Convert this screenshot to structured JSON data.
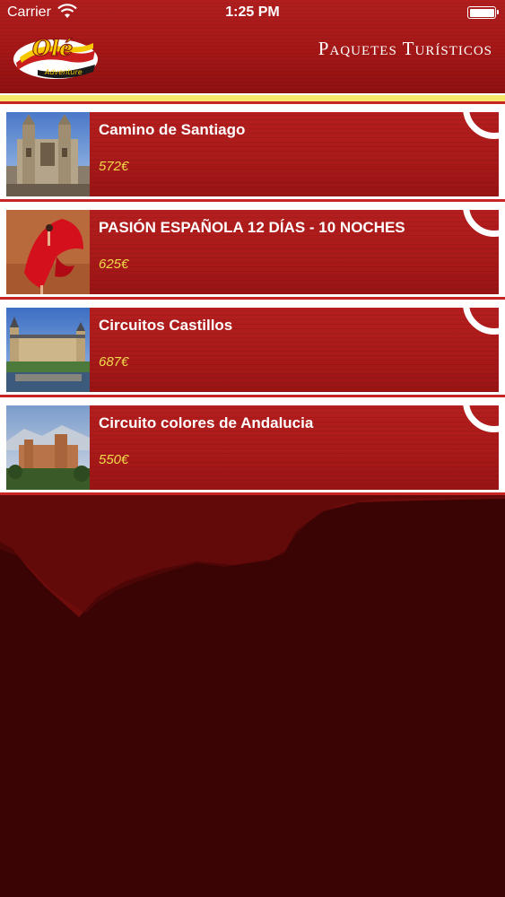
{
  "status_bar": {
    "carrier": "Carrier",
    "time": "1:25 PM"
  },
  "header": {
    "logo_text": "Olé",
    "logo_subtext": "Adventure",
    "title": "Paquetes Turísticos"
  },
  "colors": {
    "header_red": "#a51717",
    "accent_yellow": "#f6e86a",
    "price_yellow": "#f2dc4a",
    "background_dark": "#3a0404"
  },
  "packages": [
    {
      "name": "Camino de Santiago",
      "price": "572€",
      "image_icon": "cathedral-photo"
    },
    {
      "name": "PASIÓN ESPAÑOLA 12 DÍAS - 10 NOCHES",
      "price": "625€",
      "image_icon": "flamenco-dancer-photo"
    },
    {
      "name": "Circuitos Castillos",
      "price": "687€",
      "image_icon": "castle-photo"
    },
    {
      "name": "Circuito colores de Andalucia",
      "price": "550€",
      "image_icon": "alhambra-photo"
    }
  ]
}
